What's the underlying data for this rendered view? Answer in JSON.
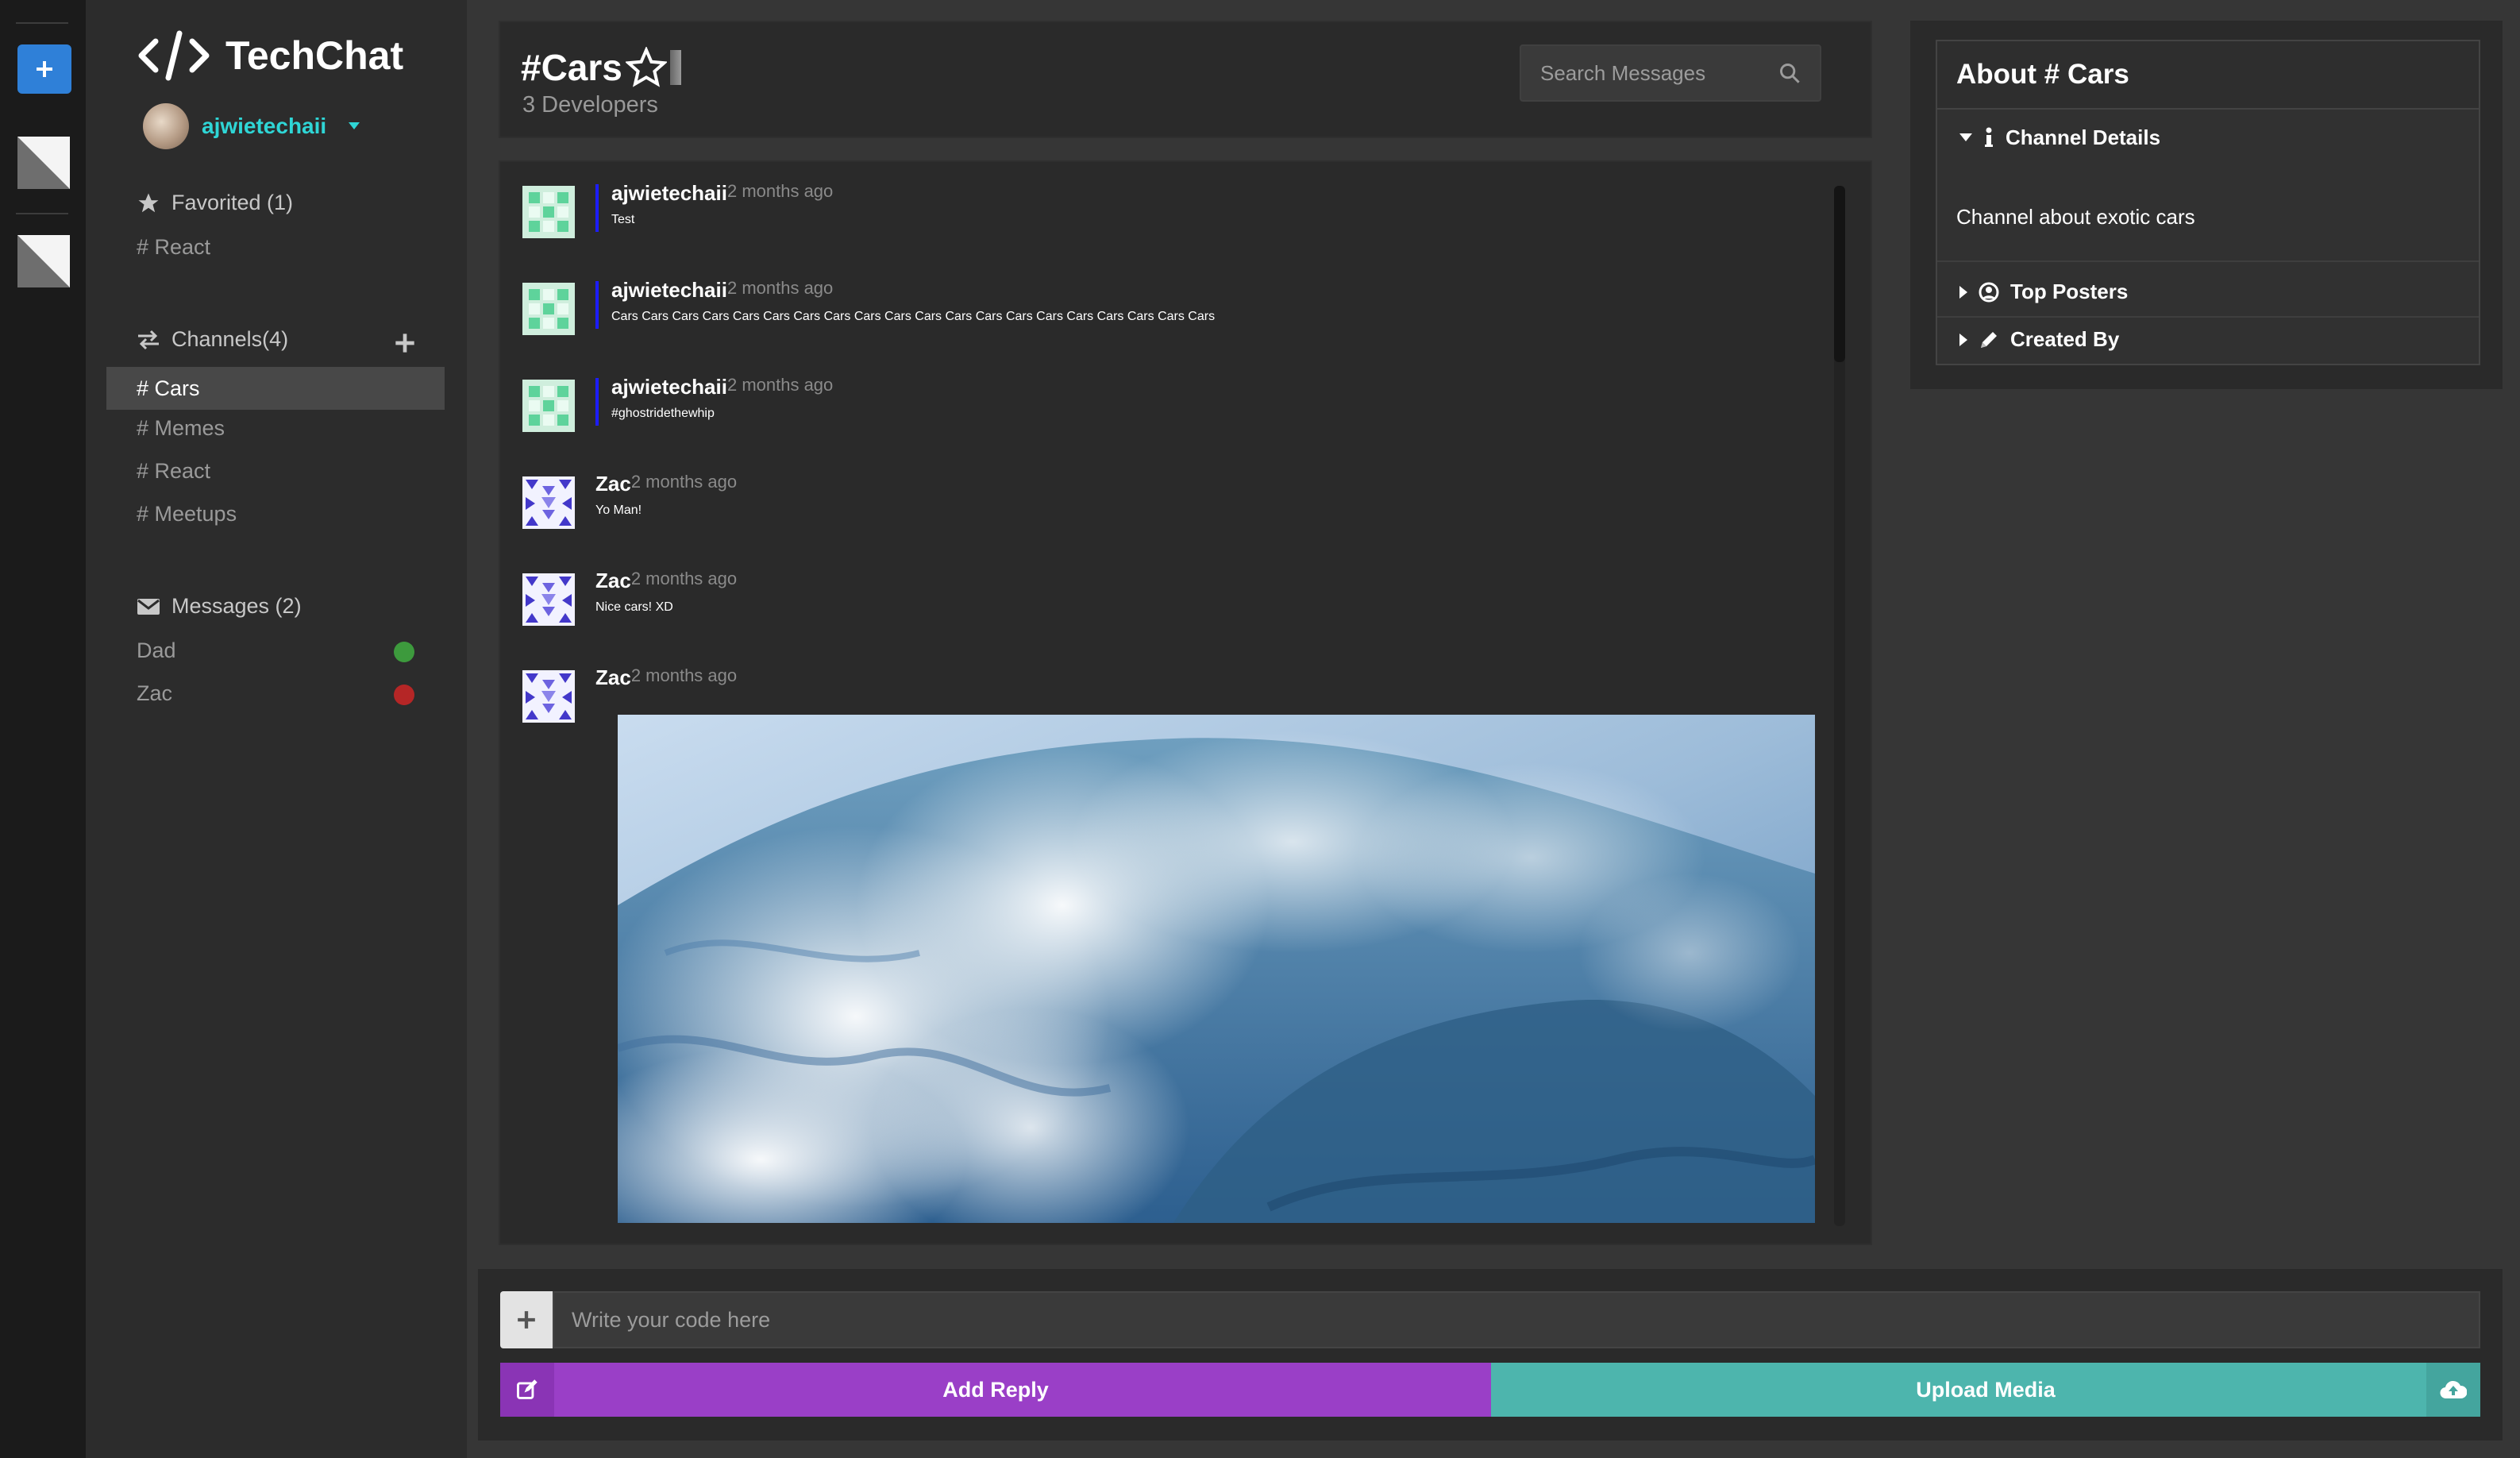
{
  "app": {
    "brand": "TechChat",
    "username": "ajwietechaii"
  },
  "sidebar": {
    "favorited": {
      "label": "Favorited (1)",
      "items": [
        "# React"
      ]
    },
    "channels": {
      "label": "Channels(4)",
      "items": [
        "# Cars",
        "# Memes",
        "# React",
        "# Meetups"
      ],
      "active": "# Cars"
    },
    "messages": {
      "label": "Messages (2)",
      "items": [
        {
          "name": "Dad",
          "status_color": "#3d9a3d"
        },
        {
          "name": "Zac",
          "status_color": "#b52626"
        }
      ]
    }
  },
  "header": {
    "title": "#Cars",
    "subtitle": "3 Developers",
    "search_placeholder": "Search Messages"
  },
  "messages": [
    {
      "author": "ajwietechaii",
      "time": "2 months ago",
      "text": "Test"
    },
    {
      "author": "ajwietechaii",
      "time": "2 months ago",
      "text": "Cars Cars Cars Cars Cars Cars Cars Cars Cars Cars Cars Cars Cars Cars Cars Cars Cars Cars Cars Cars"
    },
    {
      "author": "ajwietechaii",
      "time": "2 months ago",
      "text": "#ghostridethewhip"
    },
    {
      "author": "Zac",
      "time": "2 months ago",
      "text": "Yo Man!"
    },
    {
      "author": "Zac",
      "time": "2 months ago",
      "text": "Nice cars! XD"
    },
    {
      "author": "Zac",
      "time": "2 months ago",
      "text": ""
    }
  ],
  "about": {
    "title": "About # Cars",
    "sections": {
      "details": "Channel Details",
      "details_text": "Channel about exotic cars",
      "top_posters": "Top Posters",
      "created_by": "Created By"
    }
  },
  "composer": {
    "placeholder": "Write your code here",
    "reply_label": "Add Reply",
    "upload_label": "Upload Media"
  },
  "colors": {
    "accent_teal": "#4db5ad",
    "accent_purple": "#9a3fc7",
    "username": "#2fd6d6",
    "rail_button": "#2f80d8"
  }
}
